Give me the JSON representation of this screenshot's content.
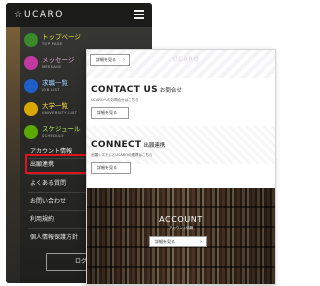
{
  "menu": {
    "logo": "UCARO",
    "items": [
      {
        "label": "トップページ",
        "sub": "TOP PAGE",
        "color": "#e8e23a",
        "circle": "#3a8a2a"
      },
      {
        "label": "メッセージ",
        "sub": "MESSAGE",
        "color": "#e6a3d6",
        "circle": "#c23aa0"
      },
      {
        "label": "求職一覧",
        "sub": "JOB LIST",
        "color": "#9fd0ff",
        "circle": "#1e5ec8"
      },
      {
        "label": "大学一覧",
        "sub": "UNIVERSITY LIST",
        "color": "#ffe14a",
        "circle": "#d8a800"
      },
      {
        "label": "スケジュール",
        "sub": "SCHEDULE",
        "color": "#b8f060",
        "circle": "#5aa800"
      }
    ],
    "links": [
      "アカウント情報",
      "出願連携",
      "よくある質問",
      "お問い合わせ",
      "利用規約",
      "個人情報保護方針"
    ],
    "bottom_button": "ログ"
  },
  "page": {
    "ghost_logo": "UCARO",
    "top_button": "詳細を見る",
    "contact": {
      "title": "CONTACT US",
      "title_jp": "お問合せ",
      "sub": "UCAROへのお問合せはこちら",
      "button": "詳細を見る"
    },
    "connect": {
      "title": "CONNECT",
      "title_jp": "出願連携",
      "sub": "出願システムとUCAROの連携はこちら",
      "button": "詳細を見る"
    },
    "account": {
      "title": "ACCOUNT",
      "sub": "アカウント情報",
      "button": "詳細を見る"
    },
    "arrow": "›"
  },
  "colors": {
    "highlight": "#e0141e",
    "menu_bg": "#2a2a28"
  }
}
